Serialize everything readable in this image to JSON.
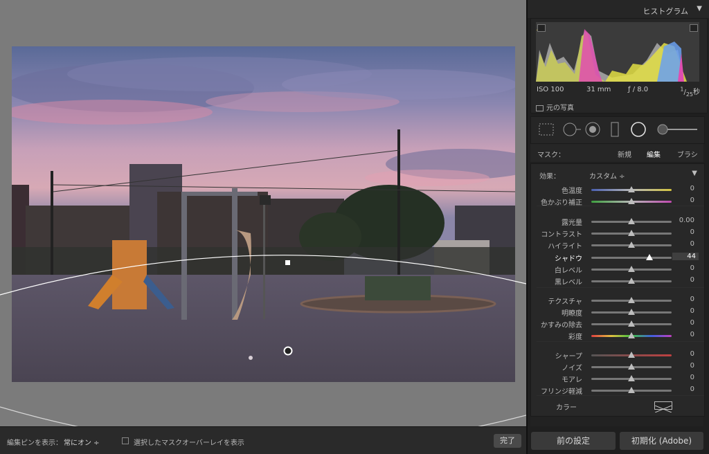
{
  "colors": {
    "panel_bg": "#1f1f1f",
    "header_bg": "#262626",
    "accent": "#c8c8c8"
  },
  "histogram": {
    "title": "ヒストグラム",
    "iso": "ISO 100",
    "focal": "31 mm",
    "aperture": "ƒ / 8.0",
    "shutter_num": "1",
    "shutter_den": "25",
    "shutter_unit": "秒",
    "original_photo_label": "元の写真"
  },
  "tools": [
    "crop-overlay-icon",
    "spot-removal-icon",
    "red-eye-icon",
    "graduated-filter-icon",
    "radial-filter-icon",
    "adjustment-brush-icon"
  ],
  "mask": {
    "label": "マスク：",
    "new": "新規",
    "edit": "編集",
    "brush": "ブラシ"
  },
  "effect": {
    "label": "効果：",
    "value": "カスタム ÷"
  },
  "sliders": [
    {
      "label": "色温度",
      "value": "0",
      "pos": 0.5
    },
    {
      "label": "色かぶり補正",
      "value": "0",
      "pos": 0.5
    },
    {
      "label": "露光量",
      "value": "0.00",
      "pos": 0.5
    },
    {
      "label": "コントラスト",
      "value": "0",
      "pos": 0.5
    },
    {
      "label": "ハイライト",
      "value": "0",
      "pos": 0.5
    },
    {
      "label": "シャドウ",
      "value": "44",
      "pos": 0.72
    },
    {
      "label": "白レベル",
      "value": "0",
      "pos": 0.5
    },
    {
      "label": "黒レベル",
      "value": "0",
      "pos": 0.5
    },
    {
      "label": "テクスチャ",
      "value": "0",
      "pos": 0.5
    },
    {
      "label": "明瞭度",
      "value": "0",
      "pos": 0.5
    },
    {
      "label": "かすみの除去",
      "value": "0",
      "pos": 0.5
    },
    {
      "label": "彩度",
      "value": "0",
      "pos": 0.5
    },
    {
      "label": "シャープ",
      "value": "0",
      "pos": 0.5
    },
    {
      "label": "ノイズ",
      "value": "0",
      "pos": 0.5
    },
    {
      "label": "モアレ",
      "value": "0",
      "pos": 0.5
    },
    {
      "label": "フリンジ軽減",
      "value": "0",
      "pos": 0.5
    }
  ],
  "color_label": "カラー",
  "buttons": {
    "previous": "前の設定",
    "reset": "初期化 (Adobe)"
  },
  "bottombar": {
    "pin_label": "編集ピンを表示：",
    "pin_value": "常にオン ÷",
    "overlay_label": "選択したマスクオーバーレイを表示",
    "done": "完了"
  }
}
